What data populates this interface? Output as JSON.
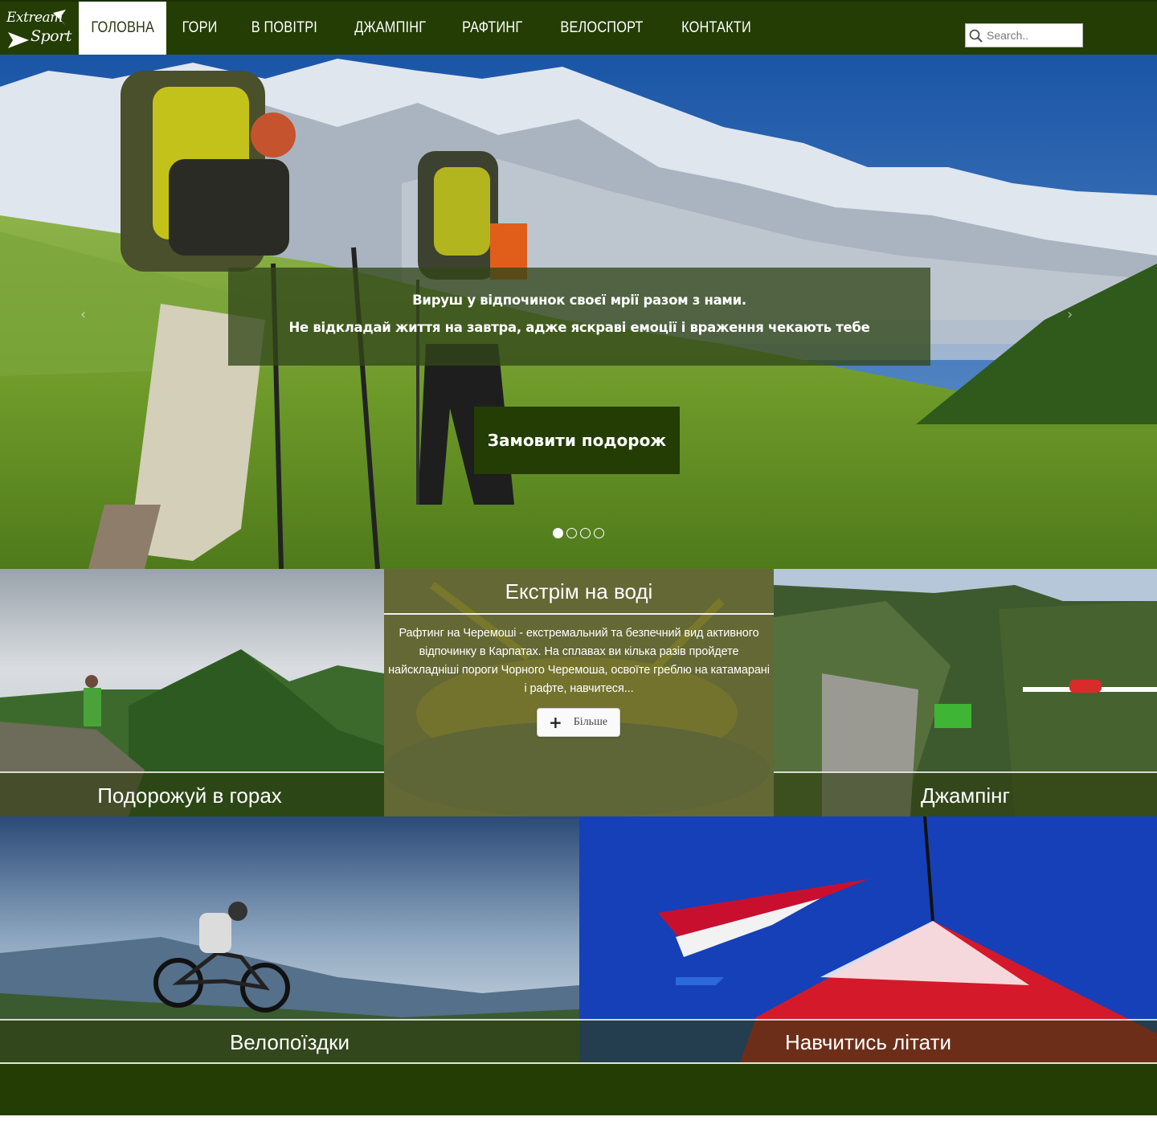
{
  "brand": {
    "line1": "Extream",
    "line2": "Sport"
  },
  "nav": {
    "items": [
      {
        "label": "ГОЛОВНА",
        "active": true
      },
      {
        "label": "ГОРИ"
      },
      {
        "label": "В ПОВІТРІ"
      },
      {
        "label": "ДЖАМПІНГ"
      },
      {
        "label": "РАФТИНГ"
      },
      {
        "label": "ВЕЛОСПОРТ"
      },
      {
        "label": "КОНТАКТИ"
      }
    ],
    "search_placeholder": "Search.."
  },
  "hero": {
    "caption_line1": "Вируш у відпочинок своєї мрії разом з нами.",
    "caption_line2": "Не відкладай життя на завтра, адже яскраві емоції і враження чекають тебе",
    "cta_label": "Замовити подорож",
    "prev_arrow": "‹",
    "next_arrow": "›",
    "slide_count": 4,
    "active_slide": 1
  },
  "tiles": {
    "mountains": {
      "label": "Подорожуй в горах"
    },
    "water": {
      "title": "Екстрім на воді",
      "text": "Рафтинг на Черемоші - екстремальний та безпечний вид активного відпочинку в Карпатах. На сплавах ви кілька разів пройдете найскладніші пороги Чорного Черемоша, освоїте греблю на катамарані і рафте, навчитеся...",
      "more_label": "Більше"
    },
    "jumping": {
      "label": "Джампінг"
    },
    "cycling": {
      "label": "Велопоїздки"
    },
    "flying": {
      "label": "Навчитись літати"
    }
  },
  "colors": {
    "brand_green": "#233d04",
    "overlay_green": "#2d3c0f"
  },
  "icons": [
    "search-icon",
    "plus-icon",
    "chevron-left-icon",
    "chevron-right-icon",
    "logo-arrow-icon"
  ]
}
